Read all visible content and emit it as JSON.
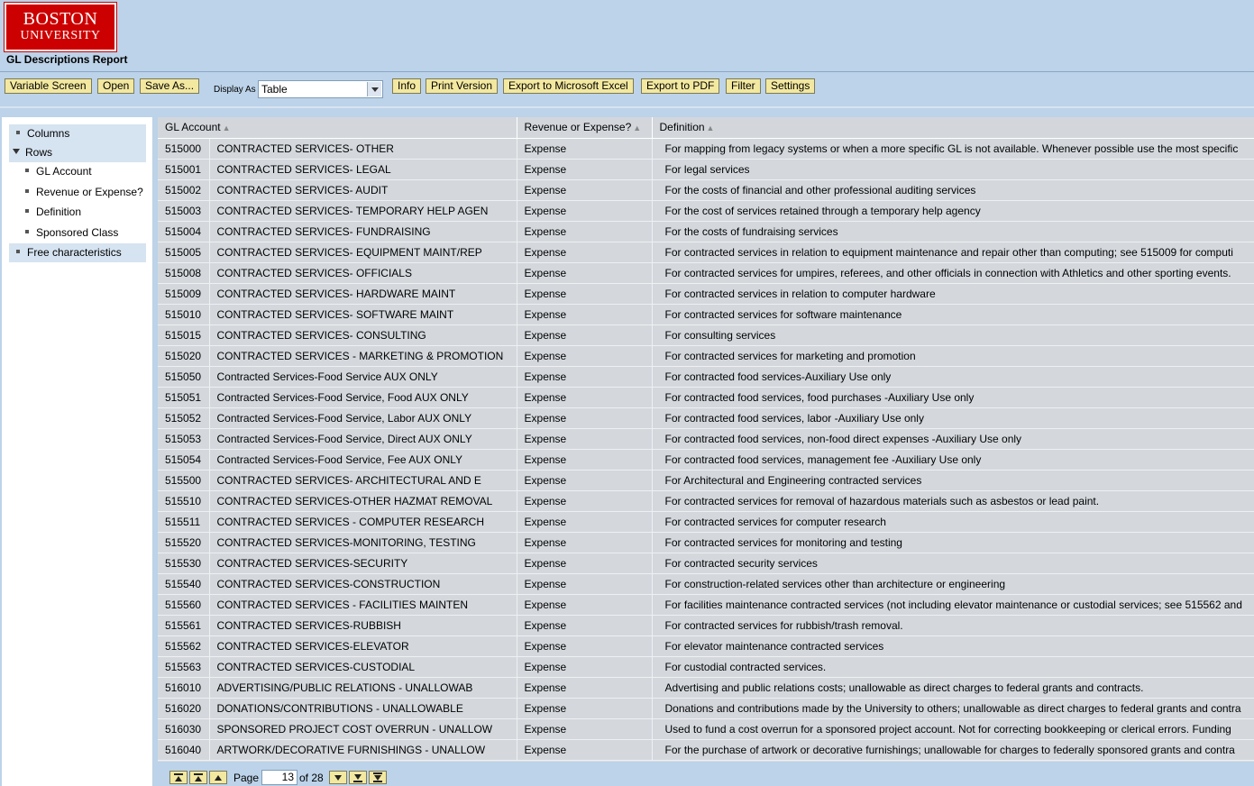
{
  "logo": {
    "line1": "BOSTON",
    "line2": "UNIVERSITY"
  },
  "report_title": "GL Descriptions Report",
  "toolbar": {
    "variable_screen": "Variable Screen",
    "open": "Open",
    "save_as": "Save As...",
    "display_as_label": "Display As",
    "display_as_value": "Table",
    "info": "Info",
    "print_version": "Print Version",
    "export_excel": "Export to Microsoft Excel",
    "export_pdf": "Export to PDF",
    "filter": "Filter",
    "settings": "Settings"
  },
  "nav": {
    "columns": "Columns",
    "rows": "Rows",
    "gl_account": "GL Account",
    "revenue_or_expense": "Revenue or Expense?",
    "definition": "Definition",
    "sponsored_class": "Sponsored Class",
    "free_characteristics": "Free characteristics"
  },
  "table": {
    "headers": {
      "gl_account": "GL Account",
      "rev_exp": "Revenue or Expense?",
      "definition": "Definition"
    },
    "rows": [
      [
        "515000",
        "CONTRACTED SERVICES- OTHER",
        "Expense",
        "For mapping from legacy systems or when a more specific GL is not available.  Whenever possible use the most specific"
      ],
      [
        "515001",
        "CONTRACTED SERVICES- LEGAL",
        "Expense",
        "For legal services"
      ],
      [
        "515002",
        "CONTRACTED SERVICES- AUDIT",
        "Expense",
        "For the costs of financial and other professional auditing services"
      ],
      [
        "515003",
        "CONTRACTED SERVICES- TEMPORARY HELP AGEN",
        "Expense",
        "For the cost of services retained through a temporary help agency"
      ],
      [
        "515004",
        "CONTRACTED SERVICES- FUNDRAISING",
        "Expense",
        "For the costs of fundraising services"
      ],
      [
        "515005",
        "CONTRACTED SERVICES- EQUIPMENT MAINT/REP",
        "Expense",
        "For contracted services in relation to equipment maintenance and repair other than computing;  see 515009 for computi"
      ],
      [
        "515008",
        "CONTRACTED SERVICES- OFFICIALS",
        "Expense",
        "For contracted services for umpires, referees, and other officials in connection with Athletics and other sporting events."
      ],
      [
        "515009",
        "CONTRACTED SERVICES- HARDWARE MAINT",
        "Expense",
        "For contracted services in relation to computer hardware"
      ],
      [
        "515010",
        "CONTRACTED SERVICES- SOFTWARE MAINT",
        "Expense",
        "For contracted services for software maintenance"
      ],
      [
        "515015",
        "CONTRACTED SERVICES- CONSULTING",
        "Expense",
        "For consulting services"
      ],
      [
        "515020",
        "CONTRACTED SERVICES - MARKETING & PROMOTION",
        "Expense",
        "For contracted services for marketing and promotion"
      ],
      [
        "515050",
        "Contracted Services-Food Service AUX ONLY",
        "Expense",
        "For contracted food services-Auxiliary Use only"
      ],
      [
        "515051",
        "Contracted Services-Food Service, Food AUX ONLY",
        "Expense",
        "For contracted food services, food purchases -Auxiliary Use only"
      ],
      [
        "515052",
        "Contracted Services-Food Service, Labor AUX ONLY",
        "Expense",
        "For contracted food services, labor -Auxiliary Use only"
      ],
      [
        "515053",
        "Contracted Services-Food Service, Direct AUX ONLY",
        "Expense",
        "For contracted food services, non-food direct expenses -Auxiliary Use only"
      ],
      [
        "515054",
        "Contracted Services-Food Service, Fee AUX ONLY",
        "Expense",
        "For contracted food services, management fee -Auxiliary Use only"
      ],
      [
        "515500",
        "CONTRACTED SERVICES- ARCHITECTURAL AND E",
        "Expense",
        "For Architectural and Engineering contracted services"
      ],
      [
        "515510",
        "CONTRACTED SERVICES-OTHER HAZMAT REMOVAL",
        "Expense",
        "For contracted services for removal of hazardous materials such as asbestos or lead paint."
      ],
      [
        "515511",
        "CONTRACTED SERVICES - COMPUTER RESEARCH",
        "Expense",
        "For contracted services for computer research"
      ],
      [
        "515520",
        "CONTRACTED SERVICES-MONITORING, TESTING",
        "Expense",
        "For contracted services for monitoring and testing"
      ],
      [
        "515530",
        "CONTRACTED SERVICES-SECURITY",
        "Expense",
        "For contracted security services"
      ],
      [
        "515540",
        "CONTRACTED SERVICES-CONSTRUCTION",
        "Expense",
        "For construction-related services other than architecture or engineering"
      ],
      [
        "515560",
        "CONTRACTED SERVICES - FACILITIES MAINTEN",
        "Expense",
        "For facilities maintenance contracted services (not including elevator maintenance or custodial services; see 515562 and"
      ],
      [
        "515561",
        "CONTRACTED SERVICES-RUBBISH",
        "Expense",
        "For contracted services for rubbish/trash removal."
      ],
      [
        "515562",
        "CONTRACTED SERVICES-ELEVATOR",
        "Expense",
        "For elevator maintenance contracted services"
      ],
      [
        "515563",
        "CONTRACTED SERVICES-CUSTODIAL",
        "Expense",
        "For custodial contracted services."
      ],
      [
        "516010",
        "ADVERTISING/PUBLIC RELATIONS - UNALLOWAB",
        "Expense",
        "Advertising and public relations costs; unallowable as direct charges to federal grants and contracts."
      ],
      [
        "516020",
        "DONATIONS/CONTRIBUTIONS - UNALLOWABLE",
        "Expense",
        "Donations and contributions made by the University to others; unallowable as direct charges to federal grants and contra"
      ],
      [
        "516030",
        "SPONSORED PROJECT COST OVERRUN - UNALLOW",
        "Expense",
        "Used to fund a cost overrun for a sponsored project account.  Not for correcting bookkeeping or clerical errors.  Funding"
      ],
      [
        "516040",
        "ARTWORK/DECORATIVE FURNISHINGS - UNALLOW",
        "Expense",
        "For the purchase of artwork or decorative furnishings;  unallowable for charges to federally sponsored grants and contra"
      ]
    ]
  },
  "pager": {
    "page_label": "Page",
    "current_page": "13",
    "of_label": "of 28"
  }
}
